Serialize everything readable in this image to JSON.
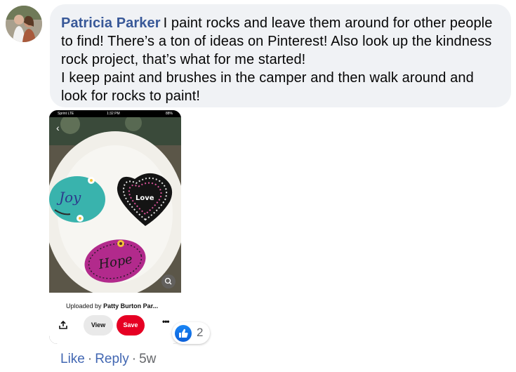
{
  "comment": {
    "author": "Patricia Parker",
    "text_line1": "I paint rocks and leave them around for other people to find! There’s a ton of ideas on Pinterest! Also look up the kindness rock project, that’s what for me started!",
    "text_line2": "I keep paint and brushes in the camper and then walk around and look for rocks to paint!"
  },
  "attachment": {
    "status_carrier": "Sprint LTE",
    "status_time": "1:32 PM",
    "status_battery": "88%",
    "rock_labels": [
      "Joy",
      "Love",
      "Hope"
    ],
    "uploaded_prefix": "Uploaded by",
    "uploaded_by": "Patty Burton Par...",
    "view_label": "View",
    "save_label": "Save",
    "more_label": "•••",
    "save_color": "#e60023"
  },
  "reactions": {
    "count": "2",
    "icon": "thumbs-up-icon",
    "color": "#1877f2"
  },
  "actions": {
    "like": "Like",
    "reply": "Reply",
    "time": "5w",
    "separator": "·"
  }
}
